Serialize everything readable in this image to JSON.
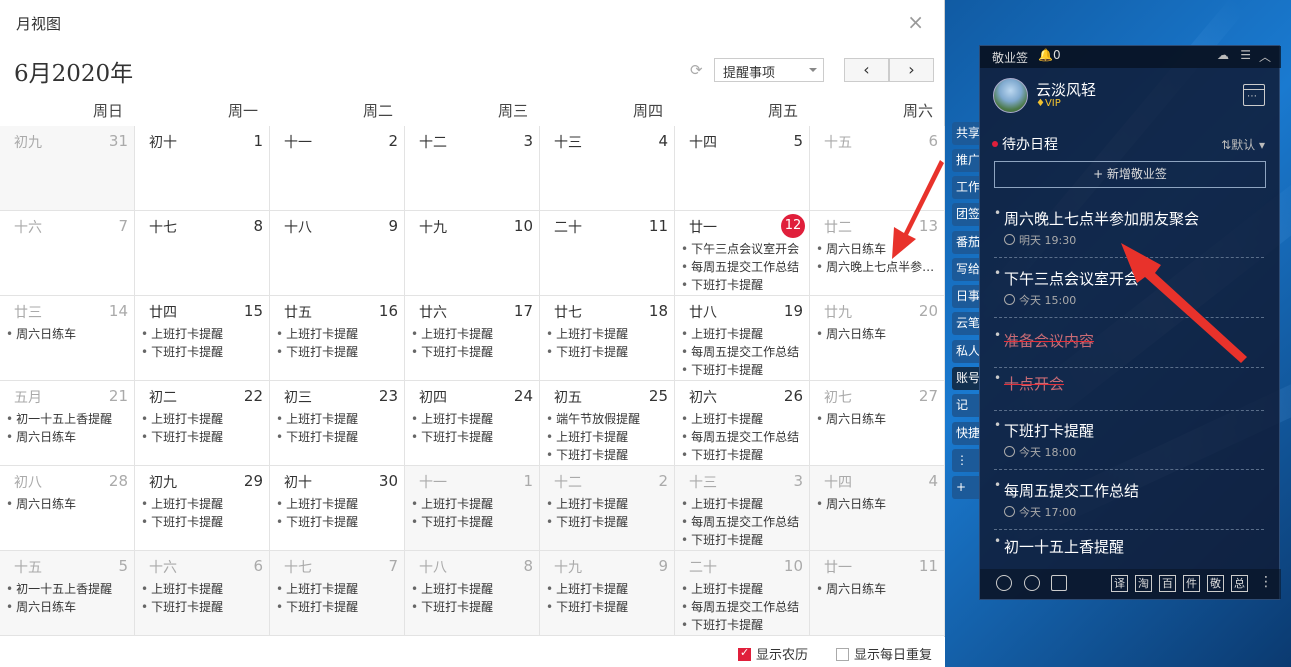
{
  "window": {
    "title": "月视图",
    "close": "×"
  },
  "header": {
    "month_title": "6月2020年",
    "filter_value": "提醒事项",
    "prev": "‹",
    "next": "›"
  },
  "weekdays": [
    "周日",
    "周一",
    "周二",
    "周三",
    "周四",
    "周五",
    "周六"
  ],
  "weeks": [
    [
      {
        "lunar": "初九",
        "day": "31",
        "other": true,
        "events": []
      },
      {
        "lunar": "初十",
        "day": "1",
        "events": []
      },
      {
        "lunar": "十一",
        "day": "2",
        "events": []
      },
      {
        "lunar": "十二",
        "day": "3",
        "events": []
      },
      {
        "lunar": "十三",
        "day": "4",
        "events": []
      },
      {
        "lunar": "十四",
        "day": "5",
        "events": []
      },
      {
        "lunar": "十五",
        "day": "6",
        "weekend": true,
        "events": []
      }
    ],
    [
      {
        "lunar": "十六",
        "day": "7",
        "weekend": true,
        "events": []
      },
      {
        "lunar": "十七",
        "day": "8",
        "events": []
      },
      {
        "lunar": "十八",
        "day": "9",
        "events": []
      },
      {
        "lunar": "十九",
        "day": "10",
        "events": []
      },
      {
        "lunar": "二十",
        "day": "11",
        "events": []
      },
      {
        "lunar": "廿一",
        "day": "12",
        "today": true,
        "events": [
          "下午三点会议室开会",
          "每周五提交工作总结",
          "下班打卡提醒"
        ]
      },
      {
        "lunar": "廿二",
        "day": "13",
        "weekend": true,
        "events": [
          "周六日练车",
          "周六晚上七点半参…"
        ]
      }
    ],
    [
      {
        "lunar": "廿三",
        "day": "14",
        "weekend": true,
        "events": [
          "周六日练车"
        ]
      },
      {
        "lunar": "廿四",
        "day": "15",
        "events": [
          "上班打卡提醒",
          "下班打卡提醒"
        ]
      },
      {
        "lunar": "廿五",
        "day": "16",
        "events": [
          "上班打卡提醒",
          "下班打卡提醒"
        ]
      },
      {
        "lunar": "廿六",
        "day": "17",
        "events": [
          "上班打卡提醒",
          "下班打卡提醒"
        ]
      },
      {
        "lunar": "廿七",
        "day": "18",
        "events": [
          "上班打卡提醒",
          "下班打卡提醒"
        ]
      },
      {
        "lunar": "廿八",
        "day": "19",
        "events": [
          "上班打卡提醒",
          "每周五提交工作总结",
          "下班打卡提醒"
        ]
      },
      {
        "lunar": "廿九",
        "day": "20",
        "weekend": true,
        "events": [
          "周六日练车"
        ]
      }
    ],
    [
      {
        "lunar": "五月",
        "day": "21",
        "weekend": true,
        "events": [
          "初一十五上香提醒",
          "周六日练车"
        ]
      },
      {
        "lunar": "初二",
        "day": "22",
        "events": [
          "上班打卡提醒",
          "下班打卡提醒"
        ]
      },
      {
        "lunar": "初三",
        "day": "23",
        "events": [
          "上班打卡提醒",
          "下班打卡提醒"
        ]
      },
      {
        "lunar": "初四",
        "day": "24",
        "events": [
          "上班打卡提醒",
          "下班打卡提醒"
        ]
      },
      {
        "lunar": "初五",
        "day": "25",
        "events": [
          "端午节放假提醒",
          "上班打卡提醒",
          "下班打卡提醒"
        ]
      },
      {
        "lunar": "初六",
        "day": "26",
        "events": [
          "上班打卡提醒",
          "每周五提交工作总结",
          "下班打卡提醒"
        ]
      },
      {
        "lunar": "初七",
        "day": "27",
        "weekend": true,
        "events": [
          "周六日练车"
        ]
      }
    ],
    [
      {
        "lunar": "初八",
        "day": "28",
        "weekend": true,
        "events": [
          "周六日练车"
        ]
      },
      {
        "lunar": "初九",
        "day": "29",
        "events": [
          "上班打卡提醒",
          "下班打卡提醒"
        ]
      },
      {
        "lunar": "初十",
        "day": "30",
        "events": [
          "上班打卡提醒",
          "下班打卡提醒"
        ]
      },
      {
        "lunar": "十一",
        "day": "1",
        "other": true,
        "events": [
          "上班打卡提醒",
          "下班打卡提醒"
        ]
      },
      {
        "lunar": "十二",
        "day": "2",
        "other": true,
        "events": [
          "上班打卡提醒",
          "下班打卡提醒"
        ]
      },
      {
        "lunar": "十三",
        "day": "3",
        "other": true,
        "events": [
          "上班打卡提醒",
          "每周五提交工作总结",
          "下班打卡提醒"
        ]
      },
      {
        "lunar": "十四",
        "day": "4",
        "other": true,
        "events": [
          "周六日练车"
        ]
      }
    ],
    [
      {
        "lunar": "十五",
        "day": "5",
        "other": true,
        "events": [
          "初一十五上香提醒",
          "周六日练车"
        ]
      },
      {
        "lunar": "十六",
        "day": "6",
        "other": true,
        "events": [
          "上班打卡提醒",
          "下班打卡提醒"
        ]
      },
      {
        "lunar": "十七",
        "day": "7",
        "other": true,
        "events": [
          "上班打卡提醒",
          "下班打卡提醒"
        ]
      },
      {
        "lunar": "十八",
        "day": "8",
        "other": true,
        "events": [
          "上班打卡提醒",
          "下班打卡提醒"
        ]
      },
      {
        "lunar": "十九",
        "day": "9",
        "other": true,
        "events": [
          "上班打卡提醒",
          "下班打卡提醒"
        ]
      },
      {
        "lunar": "二十",
        "day": "10",
        "other": true,
        "events": [
          "上班打卡提醒",
          "每周五提交工作总结",
          "下班打卡提醒"
        ]
      },
      {
        "lunar": "廿一",
        "day": "11",
        "other": true,
        "events": [
          "周六日练车"
        ]
      }
    ]
  ],
  "footer": {
    "show_lunar": "显示农历",
    "show_lunar_checked": true,
    "show_daily_repeat": "显示每日重复",
    "show_daily_repeat_checked": false
  },
  "side_tabs": [
    "共享",
    "推广",
    "工作",
    "团签",
    "番茄",
    "写给",
    "日事",
    "云笔",
    "私人",
    "账号",
    "记",
    "快捷",
    "⋮",
    "+"
  ],
  "widget": {
    "title": "敬业签",
    "bell_count": "0",
    "user_name": "云淡风轻",
    "vip": "VIP",
    "todo_title": "待办日程",
    "sort": "⇅默认",
    "add_label": "+ 新增敬业签",
    "items": [
      {
        "text": "周六晚上七点半参加朋友聚会",
        "sub": "明天 19:30",
        "done": false
      },
      {
        "text": "下午三点会议室开会",
        "sub": "今天 15:00",
        "done": false
      },
      {
        "text": "准备会议内容",
        "sub": "",
        "done": true
      },
      {
        "text": "十点开会",
        "sub": "",
        "done": true
      },
      {
        "text": "下班打卡提醒",
        "sub": "今天 18:00",
        "done": false
      },
      {
        "text": "每周五提交工作总结",
        "sub": "今天 17:00",
        "done": false
      },
      {
        "text": "初一十五上香提醒",
        "sub": "",
        "done": false
      }
    ],
    "tools": [
      "译",
      "淘",
      "百",
      "件",
      "敬",
      "总"
    ]
  },
  "colors": {
    "accent": "#e01f3b",
    "widget_bg": "#101e3a",
    "arrow": "#e8322b"
  }
}
